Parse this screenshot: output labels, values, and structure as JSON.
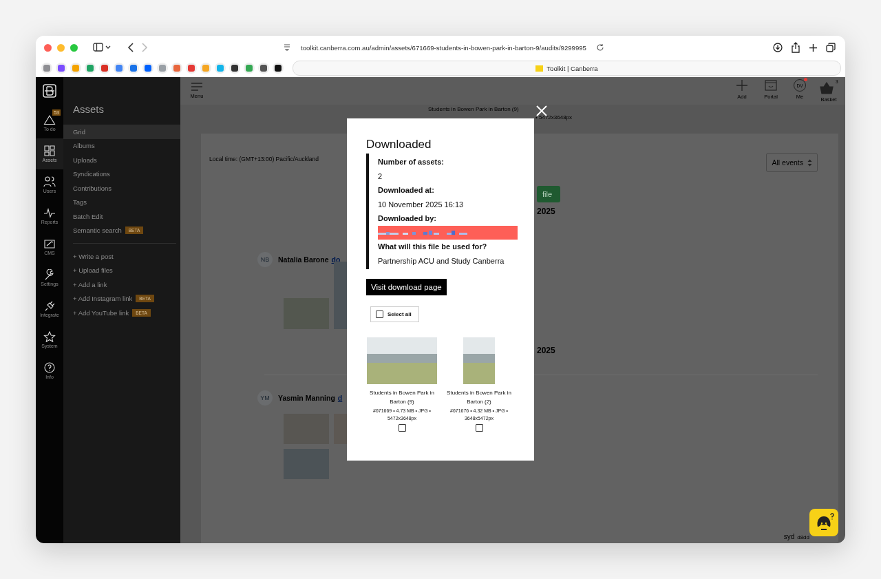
{
  "browser": {
    "url": "toolkit.canberra.com.au/admin/assets/671669-students-in-bowen-park-in-barton-9/audits/9299995",
    "tab_title": "Toolkit | Canberra",
    "bookmarks": [
      {
        "color": "#8e8e93"
      },
      {
        "color": "#7b4dff"
      },
      {
        "color": "#f4a300"
      },
      {
        "color": "#1fa463"
      },
      {
        "color": "#d93025"
      },
      {
        "color": "#4285f4"
      },
      {
        "color": "#1a73e8"
      },
      {
        "color": "#0061fe"
      },
      {
        "color": "#9aa0a6"
      },
      {
        "color": "#e8663d"
      },
      {
        "color": "#e53935"
      },
      {
        "color": "#f5a623"
      },
      {
        "color": "#13b5ea"
      },
      {
        "color": "#333333"
      },
      {
        "color": "#34a853"
      },
      {
        "color": "#555555"
      },
      {
        "color": "#111111"
      }
    ]
  },
  "rail": [
    {
      "label": "To do",
      "selected": false,
      "badge": "53"
    },
    {
      "label": "Assets",
      "selected": true
    },
    {
      "label": "Users",
      "selected": false
    },
    {
      "label": "Reports",
      "selected": false
    },
    {
      "label": "CMS",
      "selected": false
    },
    {
      "label": "Settings",
      "selected": false
    },
    {
      "label": "Integrate",
      "selected": false
    },
    {
      "label": "System",
      "selected": false
    },
    {
      "label": "Info",
      "selected": false
    }
  ],
  "sidebar": {
    "title": "Assets",
    "items": [
      {
        "label": "Grid",
        "selected": true
      },
      {
        "label": "Albums",
        "selected": false
      },
      {
        "label": "Uploads",
        "selected": false
      },
      {
        "label": "Syndications",
        "selected": false
      },
      {
        "label": "Contributions",
        "selected": false
      },
      {
        "label": "Tags",
        "selected": false
      },
      {
        "label": "Batch Edit",
        "selected": false
      },
      {
        "label": "Semantic search",
        "selected": false,
        "badge": "BETA"
      }
    ],
    "actions": [
      {
        "label": "+ Write a post"
      },
      {
        "label": "+ Upload files"
      },
      {
        "label": "+ Add a link"
      },
      {
        "label": "+ Add Instagram link",
        "badge": "BETA"
      },
      {
        "label": "+ Add YouTube link",
        "badge": "BETA"
      }
    ]
  },
  "header": {
    "menu_label": "Menu",
    "actions": [
      {
        "kind": "add",
        "label": "Add"
      },
      {
        "kind": "portal",
        "label": "Portal"
      },
      {
        "kind": "me",
        "label": "Me",
        "avatar": "DV",
        "notification": true
      },
      {
        "kind": "basket",
        "label": "Basket",
        "count": "3"
      }
    ]
  },
  "asset_info": {
    "title": "Students in Bowen Park in Barton (9)",
    "meta": "• 5472x3648px"
  },
  "events": {
    "local_time": "Local time: (GMT+13:00) Pacific/Auckland",
    "filter": "All events",
    "groups": [
      {
        "button": "file",
        "heading": "2025",
        "initials": "NB",
        "name": "Natalia Barone",
        "link": "do"
      },
      {
        "heading": "2025",
        "initials": "YM",
        "name": "Yasmin Manning",
        "link": "d"
      }
    ]
  },
  "footer": {
    "region": "syd",
    "build": "d8dd"
  },
  "modal": {
    "title": "Downloaded",
    "fields": [
      {
        "kind": "text",
        "label": "Number of assets:",
        "value": "2"
      },
      {
        "kind": "text",
        "label": "Downloaded at:",
        "value": "10 November 2025 16:13"
      },
      {
        "kind": "redacted",
        "label": "Downloaded by:"
      },
      {
        "kind": "text",
        "label": "What will this file be used for?",
        "value": "Partnership ACU and Study Canberra"
      }
    ],
    "button": "Visit download page",
    "select_all": {
      "label": "Select all",
      "checked": false
    },
    "assets": [
      {
        "title": "Students in Bowen Park in Barton (9)",
        "meta": "#671669 • 4.73 MB • JPG • 5472x3648px",
        "checked": false
      },
      {
        "title": "Students in Bowen Park in Barton (2)",
        "meta": "#671676 • 4.32 MB • JPG • 3648x5472px",
        "checked": false
      }
    ]
  }
}
